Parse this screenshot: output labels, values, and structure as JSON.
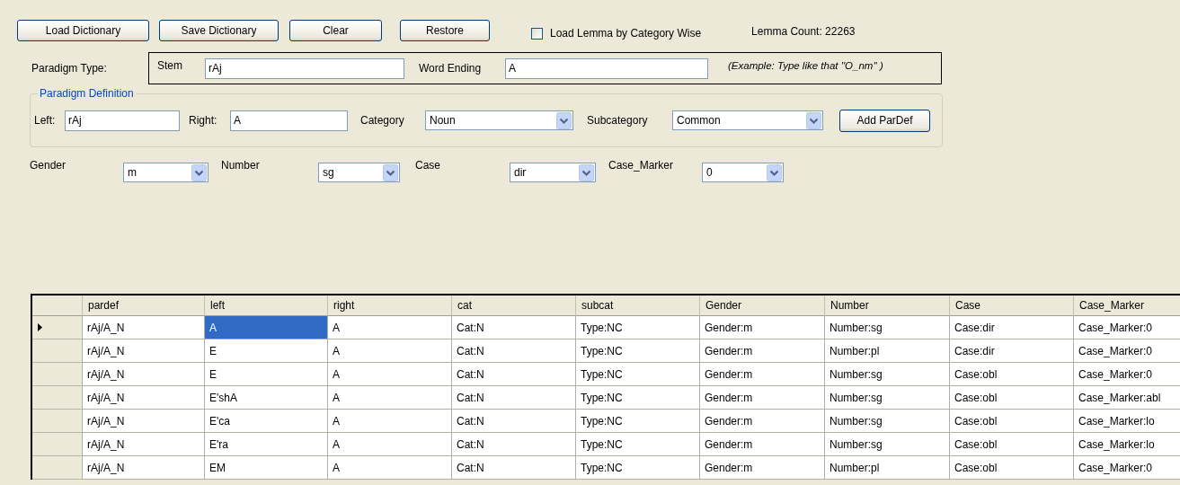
{
  "toolbar": {
    "buttons": [
      "Load Dictionary",
      "Save Dictionary",
      "Clear",
      "Restore"
    ],
    "checkbox": {
      "label": "Load Lemma by Category Wise",
      "checked": false
    },
    "lemma_count": "Lemma Count: 22263"
  },
  "paradigm_type": {
    "label": "Paradigm Type:",
    "stem_label": "Stem",
    "stem": "rAj",
    "ending_label": "Word Ending",
    "ending": "A",
    "example": "(Example: Type like that ''O_nm'' )"
  },
  "paradigm_definition": {
    "title": "Paradigm Definition",
    "left_label": "Left:",
    "left": "rAj",
    "right_label": "Right:",
    "right": "A",
    "category_label": "Category",
    "category": "Noun",
    "subcategory_label": "Subcategory",
    "subcategory": "Common",
    "button": "Add ParDef"
  },
  "features": [
    {
      "label": "Gender",
      "value": "m"
    },
    {
      "label": "Number",
      "value": "sg"
    },
    {
      "label": "Case",
      "value": "dir"
    },
    {
      "label": "Case_Marker",
      "value": "0"
    }
  ],
  "table": {
    "columns": [
      "pardef",
      "left",
      "right",
      "cat",
      "subcat",
      "Gender",
      "Number",
      "Case",
      "Case_Marker"
    ],
    "rows": [
      {
        "current": true,
        "cells": [
          {
            "text": "rAj/A_N",
            "selected": false
          },
          {
            "text": "A",
            "selected": true
          },
          {
            "text": "A",
            "selected": false
          },
          {
            "text": "Cat:N",
            "selected": false
          },
          {
            "text": "Type:NC",
            "selected": false
          },
          {
            "text": "Gender:m",
            "selected": false
          },
          {
            "text": "Number:sg",
            "selected": false
          },
          {
            "text": "Case:dir",
            "selected": false
          },
          {
            "text": "Case_Marker:0",
            "selected": false
          }
        ]
      },
      {
        "current": false,
        "cells": [
          {
            "text": "rAj/A_N",
            "selected": false
          },
          {
            "text": "E",
            "selected": false
          },
          {
            "text": "A",
            "selected": false
          },
          {
            "text": "Cat:N",
            "selected": false
          },
          {
            "text": "Type:NC",
            "selected": false
          },
          {
            "text": "Gender:m",
            "selected": false
          },
          {
            "text": "Number:pl",
            "selected": false
          },
          {
            "text": "Case:dir",
            "selected": false
          },
          {
            "text": "Case_Marker:0",
            "selected": false
          }
        ]
      },
      {
        "current": false,
        "cells": [
          {
            "text": "rAj/A_N",
            "selected": false
          },
          {
            "text": "E",
            "selected": false
          },
          {
            "text": "A",
            "selected": false
          },
          {
            "text": "Cat:N",
            "selected": false
          },
          {
            "text": "Type:NC",
            "selected": false
          },
          {
            "text": "Gender:m",
            "selected": false
          },
          {
            "text": "Number:sg",
            "selected": false
          },
          {
            "text": "Case:obl",
            "selected": false
          },
          {
            "text": "Case_Marker:0",
            "selected": false
          }
        ]
      },
      {
        "current": false,
        "cells": [
          {
            "text": "rAj/A_N",
            "selected": false
          },
          {
            "text": "E'shA",
            "selected": false
          },
          {
            "text": "A",
            "selected": false
          },
          {
            "text": "Cat:N",
            "selected": false
          },
          {
            "text": "Type:NC",
            "selected": false
          },
          {
            "text": "Gender:m",
            "selected": false
          },
          {
            "text": "Number:sg",
            "selected": false
          },
          {
            "text": "Case:obl",
            "selected": false
          },
          {
            "text": "Case_Marker:abl",
            "selected": false
          }
        ]
      },
      {
        "current": false,
        "cells": [
          {
            "text": "rAj/A_N",
            "selected": false
          },
          {
            "text": "E'ca",
            "selected": false
          },
          {
            "text": "A",
            "selected": false
          },
          {
            "text": "Cat:N",
            "selected": false
          },
          {
            "text": "Type:NC",
            "selected": false
          },
          {
            "text": "Gender:m",
            "selected": false
          },
          {
            "text": "Number:sg",
            "selected": false
          },
          {
            "text": "Case:obl",
            "selected": false
          },
          {
            "text": "Case_Marker:lo",
            "selected": false
          }
        ]
      },
      {
        "current": false,
        "cells": [
          {
            "text": "rAj/A_N",
            "selected": false
          },
          {
            "text": "E'ra",
            "selected": false
          },
          {
            "text": "A",
            "selected": false
          },
          {
            "text": "Cat:N",
            "selected": false
          },
          {
            "text": "Type:NC",
            "selected": false
          },
          {
            "text": "Gender:m",
            "selected": false
          },
          {
            "text": "Number:sg",
            "selected": false
          },
          {
            "text": "Case:obl",
            "selected": false
          },
          {
            "text": "Case_Marker:lo",
            "selected": false
          }
        ]
      },
      {
        "current": false,
        "cells": [
          {
            "text": "rAj/A_N",
            "selected": false
          },
          {
            "text": "EM",
            "selected": false
          },
          {
            "text": "A",
            "selected": false
          },
          {
            "text": "Cat:N",
            "selected": false
          },
          {
            "text": "Type:NC",
            "selected": false
          },
          {
            "text": "Gender:m",
            "selected": false
          },
          {
            "text": "Number:pl",
            "selected": false
          },
          {
            "text": "Case:obl",
            "selected": false
          },
          {
            "text": "Case_Marker:0",
            "selected": false
          }
        ]
      }
    ]
  }
}
